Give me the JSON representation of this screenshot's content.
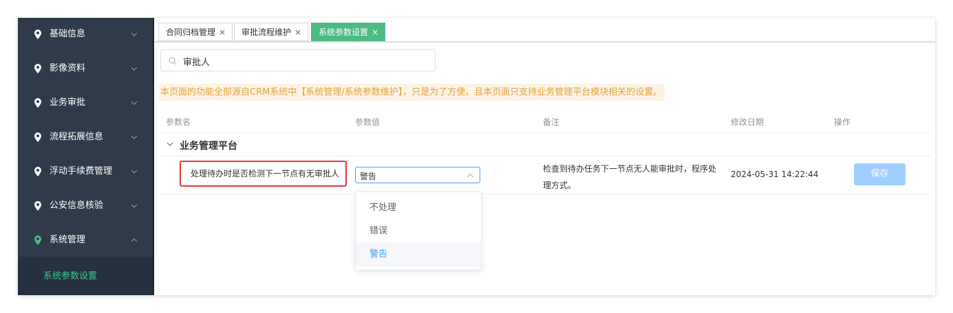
{
  "sidebar": {
    "items": [
      {
        "label": "基础信息",
        "expanded": false
      },
      {
        "label": "影像资料",
        "expanded": false
      },
      {
        "label": "业务审批",
        "expanded": false
      },
      {
        "label": "流程拓展信息",
        "expanded": false
      },
      {
        "label": "浮动手续费管理",
        "expanded": false
      },
      {
        "label": "公安信息核验",
        "expanded": false
      },
      {
        "label": "系统管理",
        "expanded": true
      }
    ],
    "sub_item": "系统参数设置"
  },
  "tabs": [
    {
      "label": "合同归档管理",
      "close": "×",
      "active": false
    },
    {
      "label": "审批流程维护",
      "close": "×",
      "active": false
    },
    {
      "label": "系统参数设置",
      "close": "×",
      "active": true
    }
  ],
  "search": {
    "value": "审批人",
    "placeholder": ""
  },
  "notice": "本页面的功能全部源自CRM系统中【系统管理/系统参数维护】，只是为了方便。且本页面只支持业务管理平台模块相关的设置。",
  "table": {
    "headers": [
      "参数名",
      "参数值",
      "备注",
      "修改日期",
      "操作"
    ],
    "group": "业务管理平台",
    "row": {
      "name": "处理待办时是否检测下一节点有无审批人",
      "value": "警告",
      "remark": "检查到待办任务下一节点无人能审批时，程序处理方式。",
      "date": "2024-05-31 14:22:44",
      "action": "保存"
    }
  },
  "dropdown": {
    "options": [
      "不处理",
      "错误",
      "警告"
    ],
    "selected": "警告"
  },
  "colors": {
    "sidebar_bg": "#2f3b4a",
    "accent_green": "#4cba83",
    "primary_blue": "#409eff",
    "warning_text": "#e6a23c",
    "highlight_red": "#e0363b"
  },
  "icons": {
    "sidebar": "map-pin-icon",
    "collapse": "chevron-down-icon",
    "expand": "chevron-up-icon",
    "search": "search-icon"
  }
}
